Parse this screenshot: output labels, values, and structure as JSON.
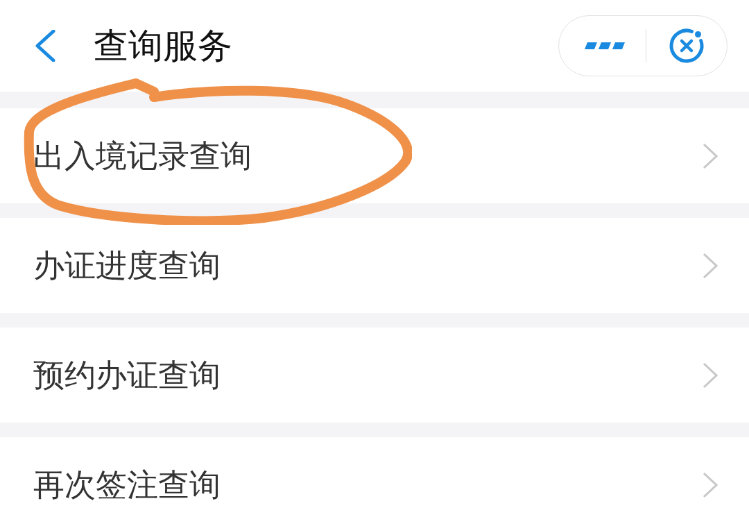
{
  "header": {
    "title": "查询服务"
  },
  "list": {
    "items": [
      {
        "label": "出入境记录查询",
        "circled": true
      },
      {
        "label": "办证进度查询",
        "circled": false
      },
      {
        "label": "预约办证查询",
        "circled": false
      },
      {
        "label": "再次签注查询",
        "circled": false
      }
    ]
  }
}
